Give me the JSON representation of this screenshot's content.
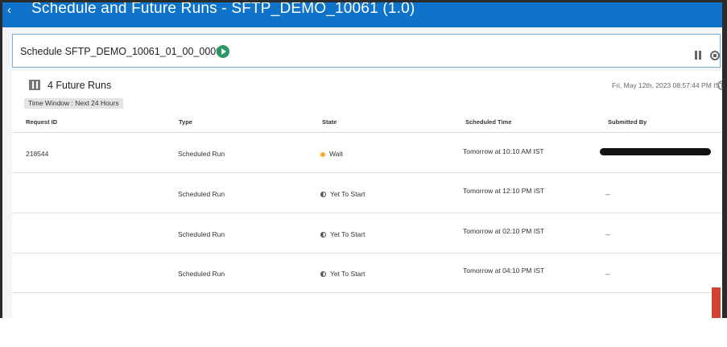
{
  "header": {
    "back_icon": "back-arrow-icon",
    "title": "Schedule and Future Runs - SFTP_DEMO_10061 (1.0)"
  },
  "schedule": {
    "name": "Schedule SFTP_DEMO_10061_01_00_0000",
    "icons": [
      "play-icon",
      "pause-icon",
      "stop-icon",
      "more-icon"
    ]
  },
  "future_runs": {
    "title": "4 Future Runs",
    "current_time": "Fri, May 12th, 2023 08:57:44 PM IST",
    "time_window": "Time Window : Next 24 Hours",
    "columns": {
      "request_id": "Request ID",
      "type": "Type",
      "state": "State",
      "scheduled_time": "Scheduled Time",
      "submitted_by": "Submitted By"
    },
    "rows": [
      {
        "request_id": "218544",
        "type": "Scheduled Run",
        "state": "Wait",
        "state_icon": "wait-dot-icon",
        "scheduled_time": "Tomorrow at 10:10 AM IST",
        "submitted_by": ""
      },
      {
        "request_id": "",
        "type": "Scheduled Run",
        "state": "Yet To Start",
        "state_icon": "half-circle-icon",
        "scheduled_time": "Tomorrow at 12:10 PM IST",
        "submitted_by": "--"
      },
      {
        "request_id": "",
        "type": "Scheduled Run",
        "state": "Yet To Start",
        "state_icon": "half-circle-icon",
        "scheduled_time": "Tomorrow at 02:10 PM IST",
        "submitted_by": "--"
      },
      {
        "request_id": "",
        "type": "Scheduled Run",
        "state": "Yet To Start",
        "state_icon": "half-circle-icon",
        "scheduled_time": "Tomorrow at 04:10 PM IST",
        "submitted_by": "--"
      }
    ]
  },
  "colors": {
    "header_bg": "#0f74c9",
    "run_button": "#2b9a62",
    "wait_dot": "#f0b323",
    "scroll_marker": "#d1432f"
  }
}
